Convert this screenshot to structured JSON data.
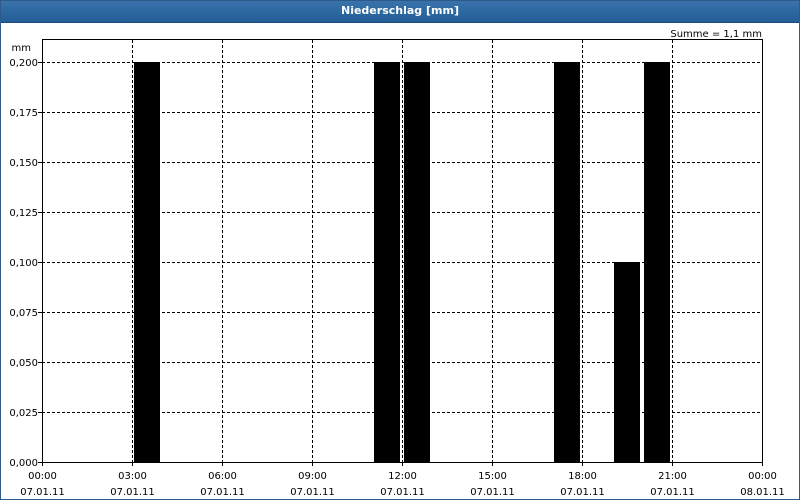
{
  "window": {
    "title": "Niederschlag [mm]"
  },
  "chart_data": {
    "type": "bar",
    "title": "Niederschlag [mm]",
    "ylabel": "mm",
    "sum_label": "Summe = 1,1 mm",
    "ylim": [
      0,
      0.2
    ],
    "y_ticks": [
      {
        "value": 0.0,
        "label": "0,000"
      },
      {
        "value": 0.025,
        "label": "0,025"
      },
      {
        "value": 0.05,
        "label": "0,050"
      },
      {
        "value": 0.075,
        "label": "0,075"
      },
      {
        "value": 0.1,
        "label": "0,100"
      },
      {
        "value": 0.125,
        "label": "0,125"
      },
      {
        "value": 0.15,
        "label": "0,150"
      },
      {
        "value": 0.175,
        "label": "0,175"
      },
      {
        "value": 0.2,
        "label": "0,200"
      }
    ],
    "x_range_hours": [
      0,
      24
    ],
    "x_ticks": [
      {
        "hour": 0,
        "time": "00:00",
        "date": "07.01.11"
      },
      {
        "hour": 3,
        "time": "03:00",
        "date": "07.01.11"
      },
      {
        "hour": 6,
        "time": "06:00",
        "date": "07.01.11"
      },
      {
        "hour": 9,
        "time": "09:00",
        "date": "07.01.11"
      },
      {
        "hour": 12,
        "time": "12:00",
        "date": "07.01.11"
      },
      {
        "hour": 15,
        "time": "15:00",
        "date": "07.01.11"
      },
      {
        "hour": 18,
        "time": "18:00",
        "date": "07.01.11"
      },
      {
        "hour": 21,
        "time": "21:00",
        "date": "07.01.11"
      },
      {
        "hour": 24,
        "time": "00:00",
        "date": "08.01.11"
      }
    ],
    "bars": [
      {
        "start_hour": 3,
        "end_hour": 4,
        "value": 0.2
      },
      {
        "start_hour": 11,
        "end_hour": 12,
        "value": 0.2
      },
      {
        "start_hour": 12,
        "end_hour": 13,
        "value": 0.2
      },
      {
        "start_hour": 17,
        "end_hour": 18,
        "value": 0.2
      },
      {
        "start_hour": 19,
        "end_hour": 20,
        "value": 0.1
      },
      {
        "start_hour": 20,
        "end_hour": 21,
        "value": 0.2
      }
    ],
    "grid": true,
    "bar_color": "#000000",
    "title_bar_color": "#2a66a0"
  }
}
